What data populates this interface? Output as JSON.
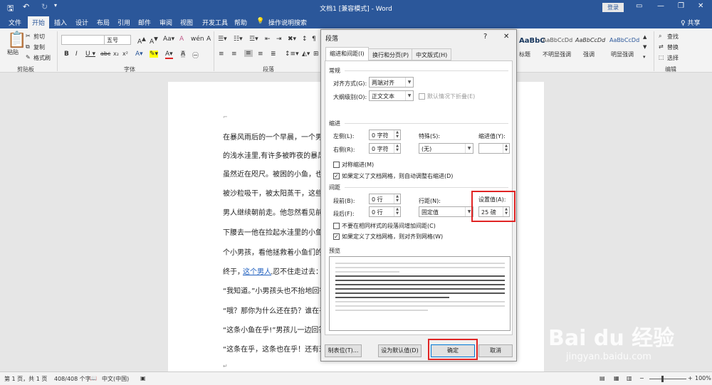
{
  "title": {
    "text": "文档1 [兼容模式] - Word",
    "login": "登录",
    "share": "♀ 共享"
  },
  "tabs": [
    "文件",
    "开始",
    "插入",
    "设计",
    "布局",
    "引用",
    "邮件",
    "审阅",
    "视图",
    "开发工具",
    "帮助"
  ],
  "tell_me": "操作说明搜索",
  "ribbon": {
    "paste": "粘贴",
    "cut": "剪切",
    "copy": "复制",
    "painter": "格式刷",
    "font_size": "五号",
    "groups": {
      "clipboard": "剪贴板",
      "font": "字体",
      "paragraph": "段落",
      "editing": "编辑"
    },
    "styles": [
      "AaBbC",
      "AaBbCcDd",
      "AaBbCcDd",
      "AaBbCcDd"
    ],
    "style_names": [
      "标题",
      "不明显强调",
      "强调",
      "明显强调"
    ],
    "find": "查找",
    "replace": "替换",
    "select": "选择"
  },
  "doc_lines": [
    "在暴风雨后的一个早晨，一个男人",
    "的浅水洼里,有许多被昨夜的暴风雨",
    "虽然近在咫尺。被困的小鱼，也许",
    "被沙粒吸干，被太阳蒸干，这些小",
    "男人继续朝前走。他忽然看见前面",
    "下腰去一他在捡起水洼里的小鱼，",
    "个小男孩，看他拯救着小鱼们的生",
    "终于，这个男人忍不住走过去：“孩",
    "“我知道。”小男孩头也不抬地回答",
    "“哦？那你为什么还在扔？谁在乎",
    "“这条小鱼在乎!”男孩儿一边回答",
    "“这条在乎，这条也在乎！还有这"
  ],
  "link_text": "这个男人",
  "status": {
    "page": "第 1 页，共 1 页",
    "words": "408/408 个字",
    "lang": "中文(中国)",
    "zoom": "100%"
  },
  "dialog": {
    "title": "段落",
    "help": "?",
    "close": "✕",
    "tabs": [
      "缩进和间距(I)",
      "换行和分页(P)",
      "中文版式(H)"
    ],
    "general": "常规",
    "align_label": "对齐方式(G):",
    "align_value": "两端对齐",
    "outline_label": "大纲级别(O):",
    "outline_value": "正文文本",
    "collapse_label": "默认情况下折叠(E)",
    "indent": "缩进",
    "left_label": "左侧(L):",
    "left_value": "0 字符",
    "right_label": "右侧(R):",
    "right_value": "0 字符",
    "special_label": "特殊(S):",
    "special_value": "(无)",
    "indent_by_label": "缩进值(Y):",
    "indent_by_value": "",
    "mirror_label": "对称缩进(M)",
    "auto_right_label": "如果定义了文档网格，则自动调整右缩进(D)",
    "spacing": "间距",
    "before_label": "段前(B):",
    "before_value": "0 行",
    "after_label": "段后(F):",
    "after_value": "0 行",
    "line_label": "行距(N):",
    "line_value": "固定值",
    "at_label": "设置值(A):",
    "at_value": "25 磅",
    "no_space_label": "不要在相同样式的段落间增加间距(C)",
    "snap_label": "如果定义了文档网格，则对齐到网格(W)",
    "preview": "预览",
    "tabs_button": "制表位(T)...",
    "default_button": "设为默认值(D)",
    "ok_button": "确定",
    "cancel_button": "取消"
  },
  "watermark": {
    "brand": "Bai du 经验",
    "url": "jingyan.baidu.com"
  },
  "colors": {
    "accent": "#2b579a",
    "highlight": "#e02424"
  }
}
